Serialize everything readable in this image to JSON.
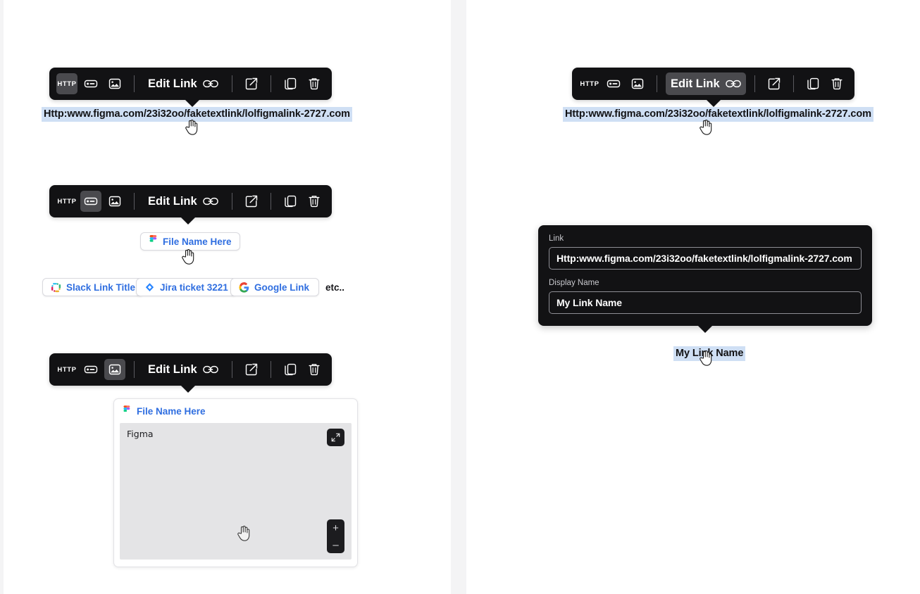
{
  "toolbars": [
    {
      "id": "toolbar-http-selected",
      "buttons": [
        {
          "name": "http-icon",
          "label": "HTTP",
          "selected": true
        },
        {
          "name": "chip-icon",
          "label": "",
          "selected": false
        },
        {
          "name": "image-icon",
          "label": "",
          "selected": false
        }
      ],
      "edit_link_label": "Edit Link",
      "edit_link_selected": false,
      "actions": [
        "open-external-icon",
        "copy-icon",
        "trash-icon"
      ]
    },
    {
      "id": "toolbar-chip-selected",
      "buttons": [
        {
          "name": "http-icon",
          "label": "HTTP",
          "selected": false
        },
        {
          "name": "chip-icon",
          "label": "",
          "selected": true
        },
        {
          "name": "image-icon",
          "label": "",
          "selected": false
        }
      ],
      "edit_link_label": "Edit Link",
      "edit_link_selected": false,
      "actions": [
        "open-external-icon",
        "copy-icon",
        "trash-icon"
      ]
    },
    {
      "id": "toolbar-image-selected",
      "buttons": [
        {
          "name": "http-icon",
          "label": "HTTP",
          "selected": false
        },
        {
          "name": "chip-icon",
          "label": "",
          "selected": false
        },
        {
          "name": "image-icon",
          "label": "",
          "selected": true
        }
      ],
      "edit_link_label": "Edit Link",
      "edit_link_selected": false,
      "actions": [
        "open-external-icon",
        "copy-icon",
        "trash-icon"
      ]
    },
    {
      "id": "toolbar-editlink-selected",
      "buttons": [
        {
          "name": "http-icon",
          "label": "HTTP",
          "selected": false
        },
        {
          "name": "chip-icon",
          "label": "",
          "selected": false
        },
        {
          "name": "image-icon",
          "label": "",
          "selected": false
        }
      ],
      "edit_link_label": "Edit Link",
      "edit_link_selected": true,
      "actions": [
        "open-external-icon",
        "copy-icon",
        "trash-icon"
      ]
    }
  ],
  "url_text": "Http:www.figma.com/23i32oo/faketextlink/lolfigmalink-2727.com",
  "figma_chip": {
    "label": "File Name Here",
    "icon": "figma-logo-icon"
  },
  "chips": [
    {
      "label": "Slack Link Title",
      "icon": "slack-logo-icon"
    },
    {
      "label": "Jira ticket 3221",
      "icon": "jira-logo-icon"
    },
    {
      "label": "Google Link",
      "icon": "google-logo-icon"
    }
  ],
  "etc_label": "etc..",
  "preview": {
    "header_label": "File Name Here",
    "header_icon": "figma-logo-icon",
    "body_title": "Figma",
    "expand_icon": "expand-fullscreen-icon",
    "zoom_in_label": "+",
    "zoom_out_label": "–"
  },
  "dialog": {
    "link_label": "Link",
    "link_value": "Http:www.figma.com/23i32oo/faketextlink/lolfigmalink-2727.com",
    "display_name_label": "Display Name",
    "display_name_value": "My Link Name"
  },
  "result_text": "My Link Name",
  "colors": {
    "toolbar_bg": "#121214",
    "selected_btn_bg": "#4a4a4e",
    "link_blue": "#2f6ee0",
    "selection_highlight": "#cfdff4",
    "panel_bg": "#ffffff",
    "page_bg": "#f4f4f5"
  }
}
